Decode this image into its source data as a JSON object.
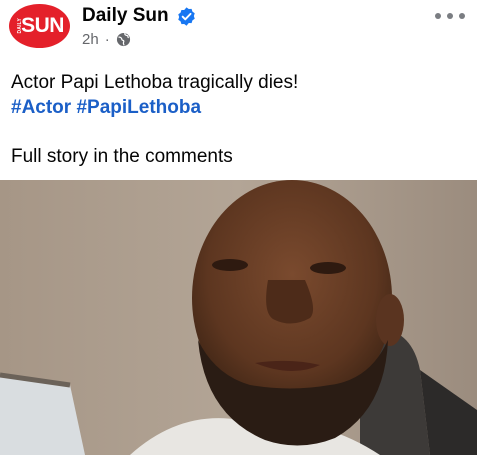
{
  "post": {
    "page_name": "Daily Sun",
    "avatar_big_text": "SUN",
    "avatar_small_text": "DAILY",
    "timestamp": "2h",
    "separator": "·",
    "text_line": "Actor Papi Lethoba tragically dies!",
    "hashtags": [
      "#Actor",
      "#PapiLethoba"
    ],
    "footer_line": "Full story in the comments"
  },
  "colors": {
    "brand_red": "#e4202a",
    "verified_blue": "#1877f2",
    "hashtag_blue": "#1b5fc7",
    "meta_gray": "#65676b"
  },
  "icons": {
    "verified": "verified-badge-icon",
    "audience": "globe-icon",
    "menu": "more-options-icon"
  }
}
